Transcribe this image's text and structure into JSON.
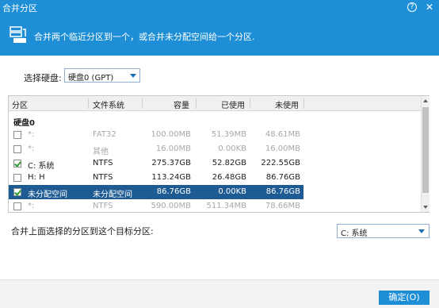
{
  "window": {
    "title": "合并分区",
    "help_glyph": "?",
    "close_glyph": "✕"
  },
  "header": {
    "description": "合并两个临近分区到一个，或合并未分配空间给一个分区."
  },
  "disk_selector": {
    "label": "选择硬盘:",
    "value": "硬盘0 (GPT)"
  },
  "table": {
    "columns": [
      "分区",
      "文件系统",
      "容量",
      "已使用",
      "未使用"
    ],
    "group": "硬盘0",
    "rows": [
      {
        "checked": false,
        "name": "*:",
        "fs": "FAT32",
        "capacity": "100.00MB",
        "used": "51.39MB",
        "free": "48.61MB",
        "dim": true,
        "selected": false
      },
      {
        "checked": false,
        "name": "*:",
        "fs": "其他",
        "capacity": "16.00MB",
        "used": "0.00KB",
        "free": "16.00MB",
        "dim": true,
        "selected": false
      },
      {
        "checked": true,
        "name": "C: 系统",
        "fs": "NTFS",
        "capacity": "275.37GB",
        "used": "52.82GB",
        "free": "222.55GB",
        "dim": false,
        "selected": false
      },
      {
        "checked": false,
        "name": "H: H",
        "fs": "NTFS",
        "capacity": "113.24GB",
        "used": "26.48GB",
        "free": "86.76GB",
        "dim": false,
        "selected": false
      },
      {
        "checked": true,
        "name": "未分配空间",
        "fs": "未分配空间",
        "capacity": "86.76GB",
        "used": "0.00KB",
        "free": "86.76GB",
        "dim": false,
        "selected": true
      },
      {
        "checked": false,
        "name": "*:",
        "fs": "NTFS",
        "capacity": "590.00MB",
        "used": "511.34MB",
        "free": "78.66MB",
        "dim": true,
        "selected": false
      }
    ]
  },
  "merge_target": {
    "label": "合并上面选择的分区到这个目标分区:",
    "value": "C: 系统"
  },
  "footer": {
    "ok_label": "确定(O)"
  },
  "colors": {
    "accent": "#1e8fd7",
    "selected_row": "#1f5b93",
    "check": "#2e9a2e"
  }
}
